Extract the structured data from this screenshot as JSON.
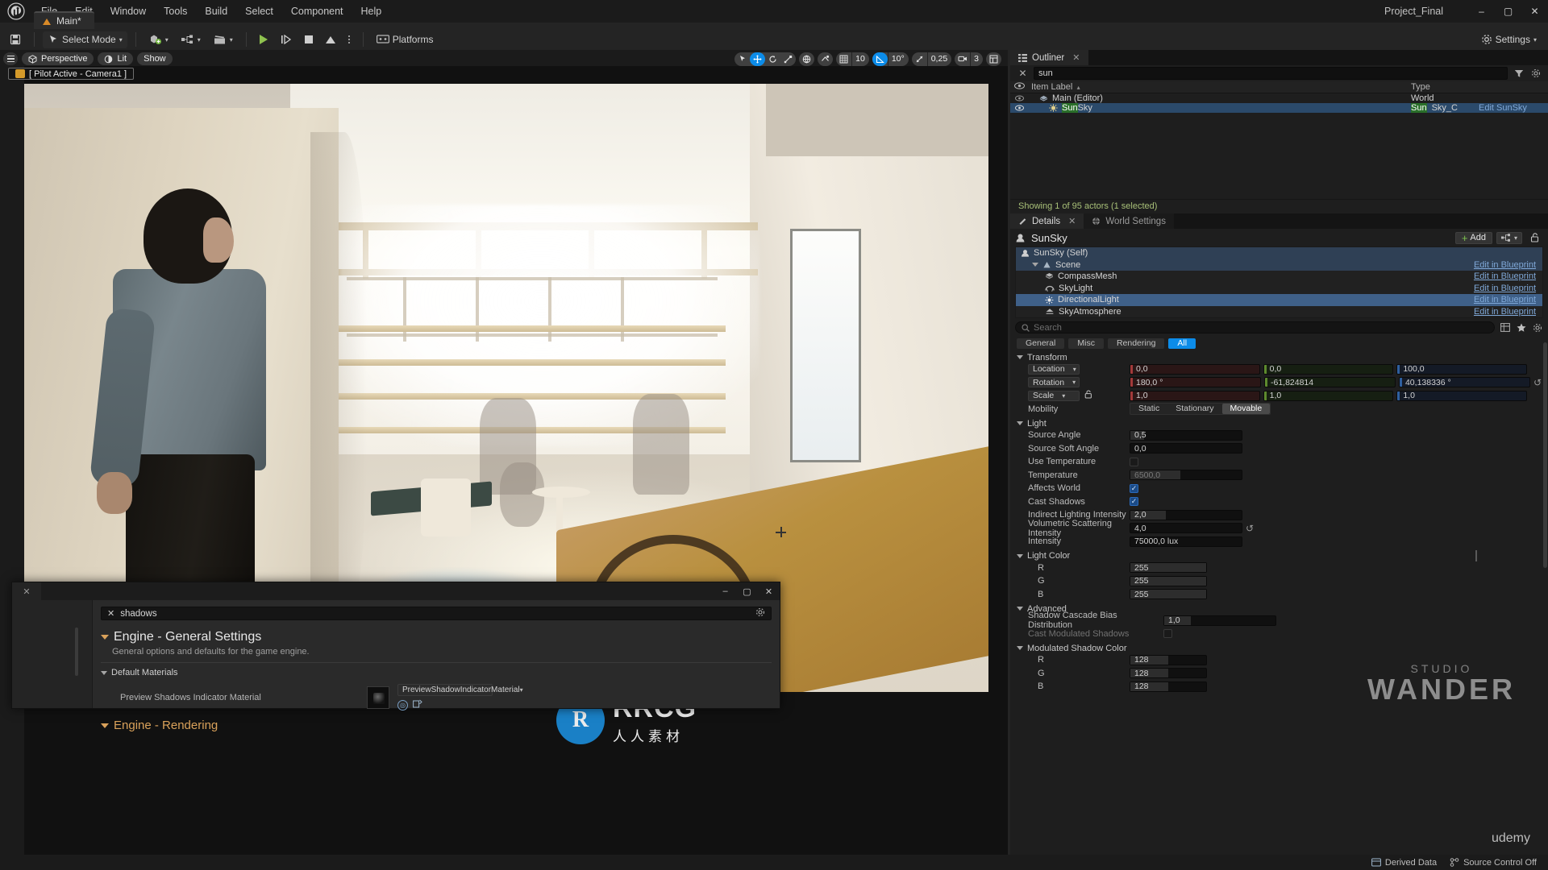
{
  "window": {
    "project_name": "Project_Final",
    "controls": {
      "minimize": "–",
      "maximize": "▢",
      "close": "✕"
    }
  },
  "menubar": {
    "logo_icon": "unreal-engine-logo",
    "items": [
      "File",
      "Edit",
      "Window",
      "Tools",
      "Build",
      "Select",
      "Component",
      "Help"
    ]
  },
  "level_tab": {
    "label": "Main*",
    "icon": "level-icon"
  },
  "toolbar": {
    "save_icon": "save-icon",
    "select_mode": "Select Mode",
    "add_icon": "add-actor-icon",
    "blueprint_icon": "blueprints-icon",
    "cinematics_icon": "cinematics-icon",
    "play_icon": "play-icon",
    "skip_icon": "step-icon",
    "stop_icon": "stop-icon",
    "eject_icon": "eject-icon",
    "more_icon": "more-options-icon",
    "platforms": "Platforms",
    "settings": "Settings"
  },
  "viewport": {
    "perspective": "Perspective",
    "lit": "Lit",
    "show": "Show",
    "pilot_banner": "[ Pilot Active - Camera1 ]",
    "grid_snap_value": "10",
    "angle_snap_value": "10°",
    "scale_snap_value": "0,25",
    "camera_speed_value": "3",
    "icons": {
      "menu": "viewport-menu-icon",
      "cube": "perspective-cube-icon",
      "lit": "lighting-mode-icon",
      "translate": "translate-gizmo-icon",
      "rotate": "rotate-gizmo-icon",
      "scale": "scale-gizmo-icon",
      "world": "world-coords-icon",
      "surface_snap": "surface-snap-icon",
      "grid_snap": "grid-snap-icon",
      "angle_snap": "angle-snap-icon",
      "scale_snap": "scale-snap-icon",
      "camera_speed": "camera-speed-icon",
      "maximize": "maximize-viewport-icon"
    }
  },
  "outliner": {
    "tab_label": "Outliner",
    "search_value": "sun",
    "search_placeholder": "Search",
    "columns": {
      "label": "Item Label",
      "type": "Type"
    },
    "rows": [
      {
        "label": "Main (Editor)",
        "type": "World",
        "selected": false,
        "indent": 14,
        "highlight": "",
        "action": ""
      },
      {
        "label": "SunSky",
        "type": "SunSky_C",
        "selected": true,
        "indent": 26,
        "highlight": "Sun",
        "action": "Edit SunSky"
      }
    ],
    "status": "Showing 1 of 95 actors (1 selected)"
  },
  "details": {
    "tabs": [
      {
        "label": "Details",
        "active": true,
        "icon": "details-icon"
      },
      {
        "label": "World Settings",
        "active": false,
        "icon": "world-settings-icon"
      }
    ],
    "actor_name": "SunSky",
    "add_label": "Add",
    "components": [
      {
        "label": "SunSky (Self)",
        "icon": "actor-icon",
        "indent": 6,
        "state": "self",
        "link": ""
      },
      {
        "label": "Scene",
        "icon": "scene-icon",
        "indent": 20,
        "state": "self",
        "link": "Edit in Blueprint"
      },
      {
        "label": "CompassMesh",
        "icon": "mesh-icon",
        "indent": 30,
        "state": "",
        "link": "Edit in Blueprint"
      },
      {
        "label": "SkyLight",
        "icon": "skylight-icon",
        "indent": 30,
        "state": "",
        "link": "Edit in Blueprint"
      },
      {
        "label": "DirectionalLight",
        "icon": "directional-light-icon",
        "indent": 30,
        "state": "sel",
        "link": "Edit in Blueprint"
      },
      {
        "label": "SkyAtmosphere",
        "icon": "sky-atmosphere-icon",
        "indent": 30,
        "state": "",
        "link": "Edit in Blueprint"
      }
    ],
    "search_placeholder": "Search",
    "filters": [
      {
        "label": "General",
        "on": false
      },
      {
        "label": "Misc",
        "on": false
      },
      {
        "label": "Rendering",
        "on": false
      },
      {
        "label": "All",
        "on": true
      }
    ],
    "sections": {
      "transform": {
        "title": "Transform",
        "location": {
          "label": "Location",
          "x": "0,0",
          "y": "0,0",
          "z": "100,0"
        },
        "rotation": {
          "label": "Rotation",
          "x": "180,0 °",
          "y": "-61,824814",
          "z": "40,138336 °"
        },
        "scale": {
          "label": "Scale",
          "x": "1,0",
          "y": "1,0",
          "z": "1,0"
        },
        "mobility": {
          "label": "Mobility",
          "options": [
            "Static",
            "Stationary",
            "Movable"
          ],
          "selected": "Movable"
        }
      },
      "light": {
        "title": "Light",
        "rows": [
          {
            "label": "Source Angle",
            "type": "num",
            "value": "0,5",
            "fill": 12
          },
          {
            "label": "Source Soft Angle",
            "type": "num",
            "value": "0,0",
            "fill": 0
          },
          {
            "label": "Use Temperature",
            "type": "check",
            "value": false
          },
          {
            "label": "Temperature",
            "type": "num-dim",
            "value": "6500,0",
            "fill": 45
          },
          {
            "label": "Affects World",
            "type": "check",
            "value": true
          },
          {
            "label": "Cast Shadows",
            "type": "check",
            "value": true
          },
          {
            "label": "Indirect Lighting Intensity",
            "type": "num",
            "value": "2,0",
            "fill": 32
          },
          {
            "label": "Volumetric Scattering Intensity",
            "type": "num-revert",
            "value": "4,0",
            "fill": 0
          },
          {
            "label": "Intensity",
            "type": "num",
            "value": "75000,0 lux",
            "fill": 0
          }
        ]
      },
      "light_color": {
        "title": "Light Color",
        "swatch_hex": "#ffffff",
        "channels": [
          {
            "label": "R",
            "value": "255"
          },
          {
            "label": "G",
            "value": "255"
          },
          {
            "label": "B",
            "value": "255"
          }
        ]
      },
      "advanced": {
        "title": "Advanced",
        "rows": [
          {
            "label": "Shadow Cascade Bias Distribution",
            "value": "1,0",
            "dim": false
          },
          {
            "label": "Cast Modulated Shadows",
            "value": "",
            "dim": true
          }
        ]
      },
      "modulated_shadow_color": {
        "title": "Modulated Shadow Color",
        "channels": [
          {
            "label": "R",
            "value": "128"
          },
          {
            "label": "G",
            "value": "128"
          },
          {
            "label": "B",
            "value": "128"
          }
        ]
      }
    }
  },
  "project_settings_dialog": {
    "search_value": "shadows",
    "search_clear_icon": "clear-icon",
    "gear_icon": "gear-icon",
    "heading": "Engine - General Settings",
    "subheading": "General options and defaults for the game engine.",
    "group": "Default Materials",
    "property_label": "Preview Shadows Indicator Material",
    "property_value": "PreviewShadowIndicatorMaterial",
    "next_heading": "Engine - Rendering",
    "window_controls": {
      "minimize": "–",
      "maximize": "▢",
      "close": "✕"
    }
  },
  "watermarks": {
    "rrcg_mark": "RRCG",
    "rrcg_sub": "人人素材",
    "rrcg_logo_letter": "R",
    "wander_top": "STUDIO",
    "wander_bottom": "WANDER",
    "udemy": "udemy"
  },
  "statusbar": {
    "derived_data": "Derived Data",
    "source_control": "Source Control Off"
  }
}
